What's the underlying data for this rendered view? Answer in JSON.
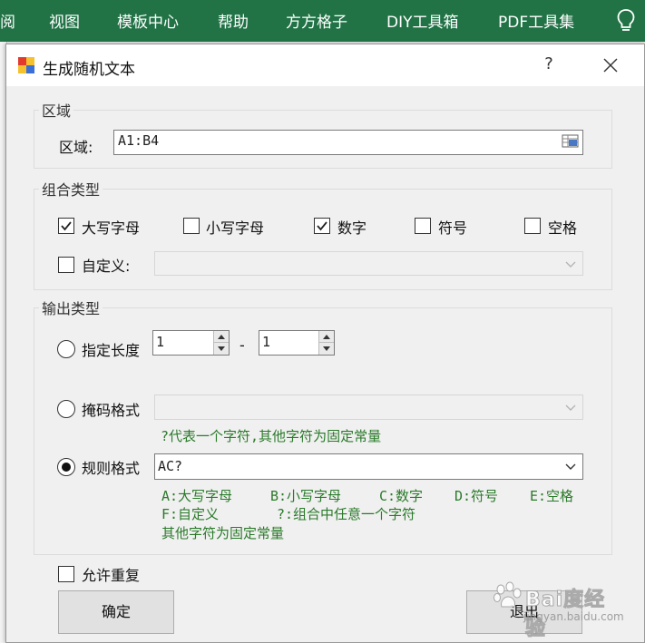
{
  "ribbon": {
    "tabs": [
      "阅",
      "视图",
      "模板中心",
      "帮助",
      "方方格子",
      "DIY工具箱",
      "PDF工具集"
    ],
    "tell_me_icon": "lightbulb-icon",
    "color": "#217346"
  },
  "dialog": {
    "title": "生成随机文本",
    "help_label": "?",
    "app_icon": "app-logo-icon",
    "close_icon": "close-icon"
  },
  "range_group": {
    "title": "区域",
    "label": "区域:",
    "value": "A1:B4",
    "picker_icon": "range-select-icon"
  },
  "combo_group": {
    "title": "组合类型",
    "options": [
      {
        "label": "大写字母",
        "checked": true
      },
      {
        "label": "小写字母",
        "checked": false
      },
      {
        "label": "数字",
        "checked": true
      },
      {
        "label": "符号",
        "checked": false
      },
      {
        "label": "空格",
        "checked": false
      }
    ],
    "custom": {
      "label": "自定义:",
      "checked": false,
      "value": ""
    }
  },
  "output_group": {
    "title": "输出类型",
    "fixed_length": {
      "label": "指定长度",
      "selected": false,
      "min": "1",
      "max": "1",
      "dash": "-"
    },
    "mask_format": {
      "label": "掩码格式",
      "selected": false,
      "value": "",
      "hint": "?代表一个字符,其他字符为固定常量"
    },
    "rule_format": {
      "label": "规则格式",
      "selected": true,
      "value": "AC?",
      "hints": [
        [
          "A:大写字母",
          "B:小写字母",
          "C:数字",
          "D:符号",
          "E:空格"
        ],
        [
          "F:自定义",
          "?:组合中任意一个字符"
        ],
        [
          "其他字符为固定常量"
        ]
      ]
    }
  },
  "allow_repeat": {
    "label": "允许重复",
    "checked": false
  },
  "buttons": {
    "ok": "确定",
    "exit": "退出"
  },
  "watermark": {
    "text": "Bai度经验",
    "url": "jingyan.baidu.com"
  },
  "colors": {
    "hint_green": "#2a7a2a",
    "dialog_bg": "#f0f0f0"
  }
}
